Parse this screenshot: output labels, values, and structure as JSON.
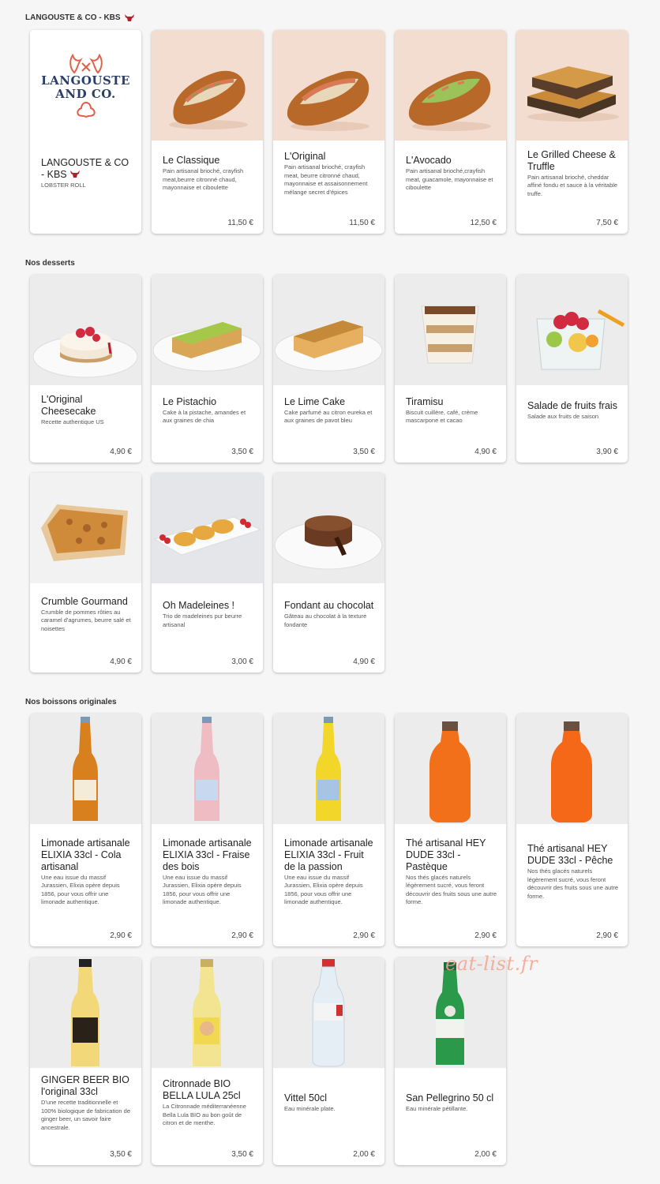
{
  "watermark": "eat-list.fr",
  "sections": {
    "lobster": {
      "title": "LANGOUSTE & CO - KBS",
      "items": [
        {
          "name": "LANGOUSTE & CO - KBS",
          "desc": "LOBSTER ROLL",
          "price": "",
          "icon": "brand-logo"
        },
        {
          "name": "Le Classique",
          "desc": "Pain artisanal brioché, crayfish meat,beurre citronné chaud, mayonnaise et ciboulette",
          "price": "11,50 €",
          "icon": "lobster-roll-photo"
        },
        {
          "name": "L'Original",
          "desc": "Pain artisanal brioché, crayfish meat, beurre citronné chaud, mayonnaise et assaisonnement mélange secret d'épices",
          "price": "11,50 €",
          "icon": "lobster-roll-photo"
        },
        {
          "name": "L'Avocado",
          "desc": "Pain artisanal brioché,crayfish meat, guacamole, mayonnaise et ciboulette",
          "price": "12,50 €",
          "icon": "avocado-roll-photo"
        },
        {
          "name": "Le Grilled Cheese & Truffle",
          "desc": "Pain artisanal brioché, cheddar affiné fondu et sauce à la véritable truffe.",
          "price": "7,50 €",
          "icon": "grilled-cheese-photo"
        }
      ]
    },
    "desserts": {
      "title": "Nos desserts",
      "items": [
        {
          "name": "L'Original Cheesecake",
          "desc": "Recette authentique US",
          "price": "4,90 €",
          "icon": "cheesecake-photo"
        },
        {
          "name": "Le Pistachio",
          "desc": "Cake à la pistache, amandes et aux graines de chia",
          "price": "3,50 €",
          "icon": "pistachio-cake-photo"
        },
        {
          "name": "Le Lime Cake",
          "desc": "Cake parfumé au citron eureka et aux graines de pavot bleu",
          "price": "3,50 €",
          "icon": "lime-cake-photo"
        },
        {
          "name": "Tiramisu",
          "desc": "Biscuit cuillère, café, crème mascarpone et cacao",
          "price": "4,90 €",
          "icon": "tiramisu-photo"
        },
        {
          "name": "Salade de fruits frais",
          "desc": "Salade aux fruits de saison",
          "price": "3,90 €",
          "icon": "fruit-salad-photo"
        },
        {
          "name": "Crumble Gourmand",
          "desc": "Crumble de pommes rôties au caramel d'agrumes, beurre salé et noisettes",
          "price": "4,90 €",
          "icon": "crumble-photo"
        },
        {
          "name": "Oh Madeleines !",
          "desc": "Trio de madeleines pur beurre artisanal",
          "price": "3,00 €",
          "icon": "madeleines-photo"
        },
        {
          "name": "Fondant au chocolat",
          "desc": "Gâteau au chocolat à la texture fondante",
          "price": "4,90 €",
          "icon": "chocolate-fondant-photo"
        }
      ]
    },
    "drinks": {
      "title": "Nos boissons originales",
      "items": [
        {
          "name": "Limonade artisanale ELIXIA 33cl - Cola artisanal",
          "desc": "Une eau issue du massif Jurassien, Elixia opère depuis 1856, pour vous offrir une limonade authentique.",
          "price": "2,90 €",
          "icon": "bottle-cola-photo"
        },
        {
          "name": "Limonade artisanale ELIXIA 33cl - Fraise des bois",
          "desc": "Une eau issue du massif Jurassien, Elixia opère depuis 1856, pour vous offrir une limonade authentique.",
          "price": "2,90 €",
          "icon": "bottle-strawberry-photo"
        },
        {
          "name": "Limonade artisanale ELIXIA 33cl - Fruit de la passion",
          "desc": "Une eau issue du massif Jurassien, Elixia opère depuis 1856, pour vous offrir une limonade authentique.",
          "price": "2,90 €",
          "icon": "bottle-passion-photo"
        },
        {
          "name": "Thé artisanal HEY DUDE 33cl - Pastèque",
          "desc": "Nos thés glacés naturels légèrement sucré, vous feront découvrir des fruits sous une autre forme.",
          "price": "2,90 €",
          "icon": "bottle-tea-watermelon-photo"
        },
        {
          "name": "Thé artisanal HEY DUDE 33cl - Pêche",
          "desc": "Nos thés glacés naturels légèrement sucré, vous feront découvrir des fruits sous une autre forme.",
          "price": "2,90 €",
          "icon": "bottle-tea-peach-photo"
        },
        {
          "name": "GINGER BEER BIO l'original 33cl",
          "desc": "D'une recette traditionnelle et 100% biologique de fabrication de ginger beer, un savoir faire ancestrale.",
          "price": "3,50 €",
          "icon": "bottle-ginger-beer-photo"
        },
        {
          "name": "Citronnade BIO BELLA LULA 25cl",
          "desc": "La Citronnade méditerranéenne Bella Lula BIO au bon goût de citron et de menthe.",
          "price": "3,50 €",
          "icon": "bottle-lemonade-photo"
        },
        {
          "name": "Vittel 50cl",
          "desc": "Eau minérale plate.",
          "price": "2,00 €",
          "icon": "bottle-water-photo"
        },
        {
          "name": "San Pellegrino 50 cl",
          "desc": "Eau minérale pétillante.",
          "price": "2,00 €",
          "icon": "bottle-sparkling-photo"
        }
      ]
    }
  },
  "colors": {
    "background": "#f6f6f6",
    "card": "#ffffff",
    "food_backdrop": "#f3ddd0",
    "dessert_backdrop": "#ececec"
  }
}
